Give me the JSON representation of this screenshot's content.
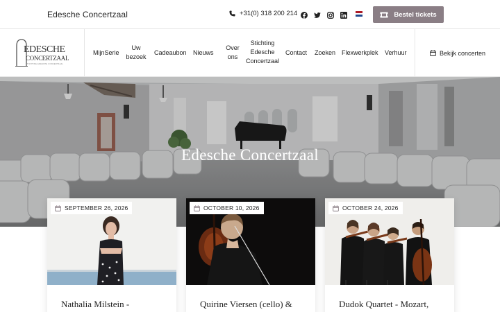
{
  "topbar": {
    "site_name": "Edesche Concertzaal",
    "phone": "+31(0) 318 200 214",
    "social_icons": [
      "facebook-icon",
      "twitter-icon",
      "instagram-icon",
      "linkedin-icon"
    ],
    "language_flag": "dutch-flag",
    "ticket_button": "Bestel tickets",
    "ticket_button_color": "#8a7e85"
  },
  "logo": {
    "line1": "EDESCHE",
    "line2": "CONCERTZAAL",
    "tagline": "STICHTING EDESCHE CONCERTZAAL"
  },
  "nav": {
    "items": [
      {
        "label": "MijnSerie"
      },
      {
        "label": "Uw bezoek"
      },
      {
        "label": "Cadeaubon"
      },
      {
        "label": "Nieuws"
      },
      {
        "label": "Over ons"
      },
      {
        "label": "Stichting Edesche Concertzaal"
      },
      {
        "label": "Contact"
      },
      {
        "label": "Zoeken"
      },
      {
        "label": "Flexwerkplek"
      },
      {
        "label": "Verhuur"
      }
    ],
    "cta": "Bekijk concerten"
  },
  "hero": {
    "title": "Edesche Concertzaal"
  },
  "events": [
    {
      "date": "SEPTEMBER 26, 2026",
      "title": "Nathalia Milstein -"
    },
    {
      "date": "OCTOBER 10, 2026",
      "title": "Quirine Viersen (cello) &"
    },
    {
      "date": "OCTOBER 24, 2026",
      "title": "Dudok Quartet - Mozart,"
    }
  ]
}
